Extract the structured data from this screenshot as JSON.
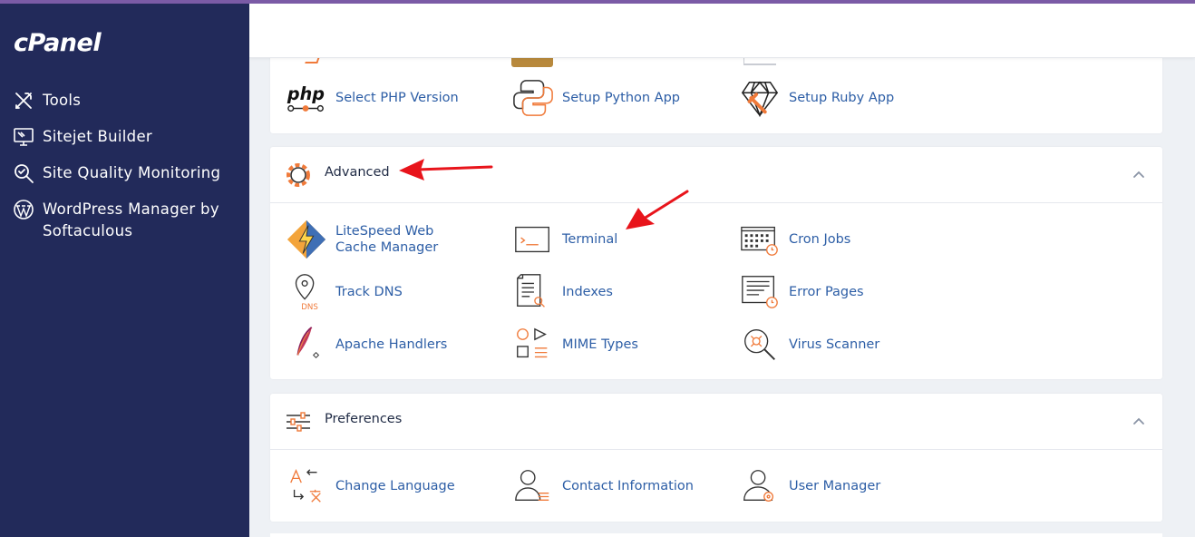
{
  "sidebar": {
    "logo": "cPanel",
    "items": [
      {
        "label": "Tools"
      },
      {
        "label": "Sitejet Builder"
      },
      {
        "label": "Site Quality Monitoring"
      },
      {
        "label": "WordPress Manager by Softaculous"
      }
    ]
  },
  "software": {
    "items": [
      {
        "label": "Select PHP Version"
      },
      {
        "label": "Setup Python App"
      },
      {
        "label": "Setup Ruby App"
      }
    ]
  },
  "advanced": {
    "title": "Advanced",
    "items": [
      {
        "label": "LiteSpeed Web Cache Manager"
      },
      {
        "label": "Terminal"
      },
      {
        "label": "Cron Jobs"
      },
      {
        "label": "Track DNS"
      },
      {
        "label": "Indexes"
      },
      {
        "label": "Error Pages"
      },
      {
        "label": "Apache Handlers"
      },
      {
        "label": "MIME Types"
      },
      {
        "label": "Virus Scanner"
      }
    ]
  },
  "preferences": {
    "title": "Preferences",
    "items": [
      {
        "label": "Change Language"
      },
      {
        "label": "Contact Information"
      },
      {
        "label": "User Manager"
      }
    ]
  },
  "icons": {
    "php_text": "php",
    "dns_text": "DNS"
  },
  "colors": {
    "sidebar_bg": "#222a5a",
    "accent_orange": "#f07a3a",
    "link_blue": "#2d5ea6",
    "annotation_red": "#e8141b"
  }
}
